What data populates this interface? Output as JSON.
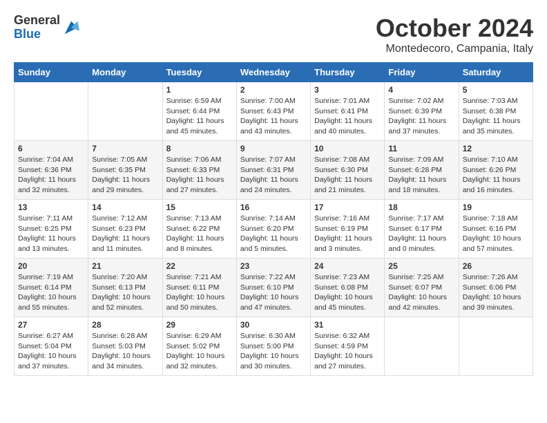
{
  "logo": {
    "general": "General",
    "blue": "Blue"
  },
  "header": {
    "month_title": "October 2024",
    "location": "Montedecoro, Campania, Italy"
  },
  "days_of_week": [
    "Sunday",
    "Monday",
    "Tuesday",
    "Wednesday",
    "Thursday",
    "Friday",
    "Saturday"
  ],
  "weeks": [
    [
      {
        "day": "",
        "content": ""
      },
      {
        "day": "",
        "content": ""
      },
      {
        "day": "1",
        "content": "Sunrise: 6:59 AM\nSunset: 6:44 PM\nDaylight: 11 hours and 45 minutes."
      },
      {
        "day": "2",
        "content": "Sunrise: 7:00 AM\nSunset: 6:43 PM\nDaylight: 11 hours and 43 minutes."
      },
      {
        "day": "3",
        "content": "Sunrise: 7:01 AM\nSunset: 6:41 PM\nDaylight: 11 hours and 40 minutes."
      },
      {
        "day": "4",
        "content": "Sunrise: 7:02 AM\nSunset: 6:39 PM\nDaylight: 11 hours and 37 minutes."
      },
      {
        "day": "5",
        "content": "Sunrise: 7:03 AM\nSunset: 6:38 PM\nDaylight: 11 hours and 35 minutes."
      }
    ],
    [
      {
        "day": "6",
        "content": "Sunrise: 7:04 AM\nSunset: 6:36 PM\nDaylight: 11 hours and 32 minutes."
      },
      {
        "day": "7",
        "content": "Sunrise: 7:05 AM\nSunset: 6:35 PM\nDaylight: 11 hours and 29 minutes."
      },
      {
        "day": "8",
        "content": "Sunrise: 7:06 AM\nSunset: 6:33 PM\nDaylight: 11 hours and 27 minutes."
      },
      {
        "day": "9",
        "content": "Sunrise: 7:07 AM\nSunset: 6:31 PM\nDaylight: 11 hours and 24 minutes."
      },
      {
        "day": "10",
        "content": "Sunrise: 7:08 AM\nSunset: 6:30 PM\nDaylight: 11 hours and 21 minutes."
      },
      {
        "day": "11",
        "content": "Sunrise: 7:09 AM\nSunset: 6:28 PM\nDaylight: 11 hours and 18 minutes."
      },
      {
        "day": "12",
        "content": "Sunrise: 7:10 AM\nSunset: 6:26 PM\nDaylight: 11 hours and 16 minutes."
      }
    ],
    [
      {
        "day": "13",
        "content": "Sunrise: 7:11 AM\nSunset: 6:25 PM\nDaylight: 11 hours and 13 minutes."
      },
      {
        "day": "14",
        "content": "Sunrise: 7:12 AM\nSunset: 6:23 PM\nDaylight: 11 hours and 11 minutes."
      },
      {
        "day": "15",
        "content": "Sunrise: 7:13 AM\nSunset: 6:22 PM\nDaylight: 11 hours and 8 minutes."
      },
      {
        "day": "16",
        "content": "Sunrise: 7:14 AM\nSunset: 6:20 PM\nDaylight: 11 hours and 5 minutes."
      },
      {
        "day": "17",
        "content": "Sunrise: 7:16 AM\nSunset: 6:19 PM\nDaylight: 11 hours and 3 minutes."
      },
      {
        "day": "18",
        "content": "Sunrise: 7:17 AM\nSunset: 6:17 PM\nDaylight: 11 hours and 0 minutes."
      },
      {
        "day": "19",
        "content": "Sunrise: 7:18 AM\nSunset: 6:16 PM\nDaylight: 10 hours and 57 minutes."
      }
    ],
    [
      {
        "day": "20",
        "content": "Sunrise: 7:19 AM\nSunset: 6:14 PM\nDaylight: 10 hours and 55 minutes."
      },
      {
        "day": "21",
        "content": "Sunrise: 7:20 AM\nSunset: 6:13 PM\nDaylight: 10 hours and 52 minutes."
      },
      {
        "day": "22",
        "content": "Sunrise: 7:21 AM\nSunset: 6:11 PM\nDaylight: 10 hours and 50 minutes."
      },
      {
        "day": "23",
        "content": "Sunrise: 7:22 AM\nSunset: 6:10 PM\nDaylight: 10 hours and 47 minutes."
      },
      {
        "day": "24",
        "content": "Sunrise: 7:23 AM\nSunset: 6:08 PM\nDaylight: 10 hours and 45 minutes."
      },
      {
        "day": "25",
        "content": "Sunrise: 7:25 AM\nSunset: 6:07 PM\nDaylight: 10 hours and 42 minutes."
      },
      {
        "day": "26",
        "content": "Sunrise: 7:26 AM\nSunset: 6:06 PM\nDaylight: 10 hours and 39 minutes."
      }
    ],
    [
      {
        "day": "27",
        "content": "Sunrise: 6:27 AM\nSunset: 5:04 PM\nDaylight: 10 hours and 37 minutes."
      },
      {
        "day": "28",
        "content": "Sunrise: 6:28 AM\nSunset: 5:03 PM\nDaylight: 10 hours and 34 minutes."
      },
      {
        "day": "29",
        "content": "Sunrise: 6:29 AM\nSunset: 5:02 PM\nDaylight: 10 hours and 32 minutes."
      },
      {
        "day": "30",
        "content": "Sunrise: 6:30 AM\nSunset: 5:00 PM\nDaylight: 10 hours and 30 minutes."
      },
      {
        "day": "31",
        "content": "Sunrise: 6:32 AM\nSunset: 4:59 PM\nDaylight: 10 hours and 27 minutes."
      },
      {
        "day": "",
        "content": ""
      },
      {
        "day": "",
        "content": ""
      }
    ]
  ]
}
